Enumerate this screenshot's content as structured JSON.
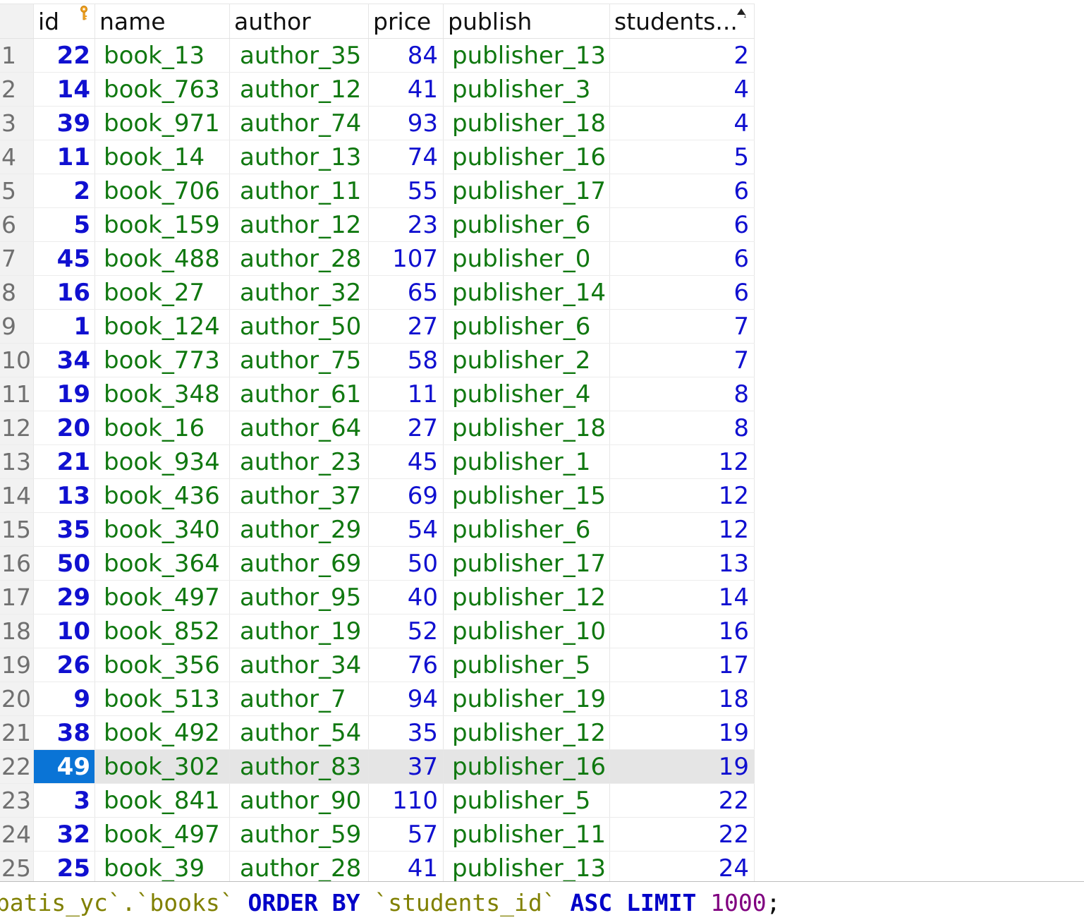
{
  "grid": {
    "columns": {
      "id": "id",
      "name": "name",
      "author": "author",
      "price": "price",
      "publish": "publish",
      "students": "students..."
    },
    "primary_key_icon": "key-icon",
    "sort_icon": "sort-ascending-icon",
    "selected_row_index": 22,
    "colors": {
      "number_text": "#1010d0",
      "string_text": "#107810",
      "selected_cell": "#0a74d6",
      "selected_row": "#e5e5e5"
    },
    "rows": [
      {
        "n": "1",
        "id": "22",
        "name": "book_13",
        "author": "author_35",
        "price": "84",
        "publish": "publisher_13",
        "students": "2"
      },
      {
        "n": "2",
        "id": "14",
        "name": "book_763",
        "author": "author_12",
        "price": "41",
        "publish": "publisher_3",
        "students": "4"
      },
      {
        "n": "3",
        "id": "39",
        "name": "book_971",
        "author": "author_74",
        "price": "93",
        "publish": "publisher_18",
        "students": "4"
      },
      {
        "n": "4",
        "id": "11",
        "name": "book_14",
        "author": "author_13",
        "price": "74",
        "publish": "publisher_16",
        "students": "5"
      },
      {
        "n": "5",
        "id": "2",
        "name": "book_706",
        "author": "author_11",
        "price": "55",
        "publish": "publisher_17",
        "students": "6"
      },
      {
        "n": "6",
        "id": "5",
        "name": "book_159",
        "author": "author_12",
        "price": "23",
        "publish": "publisher_6",
        "students": "6"
      },
      {
        "n": "7",
        "id": "45",
        "name": "book_488",
        "author": "author_28",
        "price": "107",
        "publish": "publisher_0",
        "students": "6"
      },
      {
        "n": "8",
        "id": "16",
        "name": "book_27",
        "author": "author_32",
        "price": "65",
        "publish": "publisher_14",
        "students": "6"
      },
      {
        "n": "9",
        "id": "1",
        "name": "book_124",
        "author": "author_50",
        "price": "27",
        "publish": "publisher_6",
        "students": "7"
      },
      {
        "n": "10",
        "id": "34",
        "name": "book_773",
        "author": "author_75",
        "price": "58",
        "publish": "publisher_2",
        "students": "7"
      },
      {
        "n": "11",
        "id": "19",
        "name": "book_348",
        "author": "author_61",
        "price": "11",
        "publish": "publisher_4",
        "students": "8"
      },
      {
        "n": "12",
        "id": "20",
        "name": "book_16",
        "author": "author_64",
        "price": "27",
        "publish": "publisher_18",
        "students": "8"
      },
      {
        "n": "13",
        "id": "21",
        "name": "book_934",
        "author": "author_23",
        "price": "45",
        "publish": "publisher_1",
        "students": "12"
      },
      {
        "n": "14",
        "id": "13",
        "name": "book_436",
        "author": "author_37",
        "price": "69",
        "publish": "publisher_15",
        "students": "12"
      },
      {
        "n": "15",
        "id": "35",
        "name": "book_340",
        "author": "author_29",
        "price": "54",
        "publish": "publisher_6",
        "students": "12"
      },
      {
        "n": "16",
        "id": "50",
        "name": "book_364",
        "author": "author_69",
        "price": "50",
        "publish": "publisher_17",
        "students": "13"
      },
      {
        "n": "17",
        "id": "29",
        "name": "book_497",
        "author": "author_95",
        "price": "40",
        "publish": "publisher_12",
        "students": "14"
      },
      {
        "n": "18",
        "id": "10",
        "name": "book_852",
        "author": "author_19",
        "price": "52",
        "publish": "publisher_10",
        "students": "16"
      },
      {
        "n": "19",
        "id": "26",
        "name": "book_356",
        "author": "author_34",
        "price": "76",
        "publish": "publisher_5",
        "students": "17"
      },
      {
        "n": "20",
        "id": "9",
        "name": "book_513",
        "author": "author_7",
        "price": "94",
        "publish": "publisher_19",
        "students": "18"
      },
      {
        "n": "21",
        "id": "38",
        "name": "book_492",
        "author": "author_54",
        "price": "35",
        "publish": "publisher_12",
        "students": "19"
      },
      {
        "n": "22",
        "id": "49",
        "name": "book_302",
        "author": "author_83",
        "price": "37",
        "publish": "publisher_16",
        "students": "19"
      },
      {
        "n": "23",
        "id": "3",
        "name": "book_841",
        "author": "author_90",
        "price": "110",
        "publish": "publisher_5",
        "students": "22"
      },
      {
        "n": "24",
        "id": "32",
        "name": "book_497",
        "author": "author_59",
        "price": "57",
        "publish": "publisher_11",
        "students": "22"
      },
      {
        "n": "25",
        "id": "25",
        "name": "book_39",
        "author": "author_28",
        "price": "41",
        "publish": "publisher_13",
        "students": "24"
      }
    ]
  },
  "sql": {
    "table_ref": "ybatis_yc`.`books`",
    "order_kw": "ORDER BY",
    "column_ref": "`students_id`",
    "asc_kw": "ASC",
    "limit_kw": "LIMIT",
    "limit_value": "1000",
    "terminator": ";"
  }
}
